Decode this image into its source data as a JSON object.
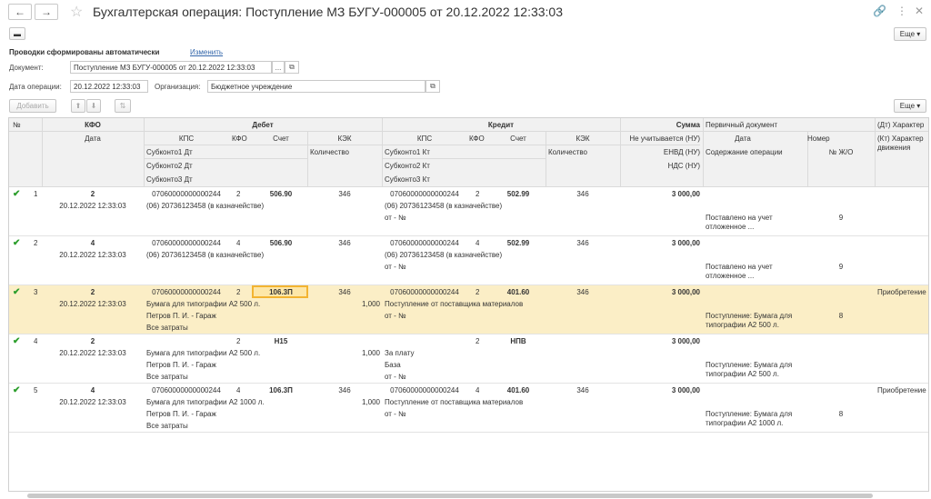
{
  "window": {
    "title": "Бухгалтерская операция: Поступление МЗ БУГУ-000005 от 20.12.2022 12:33:03",
    "more_label": "Еще"
  },
  "form": {
    "auto_text": "Проводки сформированы автоматически",
    "change_link": "Изменить",
    "document_label": "Документ:",
    "document_value": "Поступление МЗ БУГУ-000005 от 20.12.2022 12:33:03",
    "date_label": "Дата операции:",
    "date_value": "20.12.2022 12:33:03",
    "org_label": "Организация:",
    "org_value": "Бюджетное учреждение"
  },
  "toolbar": {
    "add_label": "Добавить",
    "more_label": "Еще"
  },
  "table": {
    "header": {
      "num": "№",
      "kfo": "КФО",
      "date": "Дата",
      "debit": "Дебет",
      "credit": "Кредит",
      "sum": "Сумма",
      "kps": "КПС",
      "kfo_small": "КФО",
      "account": "Счет",
      "kek": "КЭК",
      "qty": "Количество",
      "sub1_dt": "Субконто1 Дт",
      "sub2_dt": "Субконто2 Дт",
      "sub3_dt": "Субконто3 Дт",
      "sub1_kt": "Субконто1 Кт",
      "sub2_kt": "Субконто2 Кт",
      "sub3_kt": "Субконто3 Кт",
      "not_tax": "Не учитывается (НУ)",
      "envd": "ЕНВД (НУ)",
      "nds": "НДС (НУ)",
      "primary_doc": "Первичный документ",
      "pd_date": "Дата",
      "pd_number": "Номер",
      "content": "Содержание операции",
      "journal": "№ Ж/О",
      "dt_char": "(Дт) Характер",
      "kt_char": "(Кт) Характер движения"
    },
    "rows": [
      {
        "num": "1",
        "kfo": "2",
        "date": "20.12.2022 12:33:03",
        "dt_kps": "07060000000000244",
        "dt_kfo": "2",
        "dt_acc": "506.90",
        "dt_kek": "346",
        "dt_qty": "",
        "dt_sub1": "(06) 20736123458 (в казначействе)",
        "dt_sub2": "",
        "dt_sub3": "",
        "kt_kps": "07060000000000244",
        "kt_kfo": "2",
        "kt_acc": "502.99",
        "kt_kek": "346",
        "kt_qty": "",
        "kt_sub1": "(06) 20736123458 (в казначействе)",
        "kt_sub2": "от - №",
        "sum": "3 000,00",
        "content": "Поставлено на учет отложенное ...",
        "journal": "9",
        "char": ""
      },
      {
        "num": "2",
        "kfo": "4",
        "date": "20.12.2022 12:33:03",
        "dt_kps": "07060000000000244",
        "dt_kfo": "4",
        "dt_acc": "506.90",
        "dt_kek": "346",
        "dt_qty": "",
        "dt_sub1": "(06) 20736123458 (в казначействе)",
        "dt_sub2": "",
        "dt_sub3": "",
        "kt_kps": "07060000000000244",
        "kt_kfo": "4",
        "kt_acc": "502.99",
        "kt_kek": "346",
        "kt_qty": "",
        "kt_sub1": "(06) 20736123458 (в казначействе)",
        "kt_sub2": "от - №",
        "sum": "3 000,00",
        "content": "Поставлено на учет отложенное ...",
        "journal": "9",
        "char": ""
      },
      {
        "num": "3",
        "kfo": "2",
        "date": "20.12.2022 12:33:03",
        "dt_kps": "07060000000000244",
        "dt_kfo": "2",
        "dt_acc": "106.3П",
        "dt_kek": "346",
        "dt_qty": "1,000",
        "dt_sub1": "Бумага для типографии А2 500 л.",
        "dt_sub2": "Петров П. И. - Гараж",
        "dt_sub3": "Все затраты",
        "kt_kps": "07060000000000244",
        "kt_kfo": "2",
        "kt_acc": "401.60",
        "kt_kek": "346",
        "kt_qty": "",
        "kt_sub1": "Поступление от поставщика материалов",
        "kt_sub2": "от - №",
        "sum": "3 000,00",
        "content": "Поступление: Бумага для типографии А2 500 л.",
        "journal": "8",
        "char": "Приобретение"
      },
      {
        "num": "4",
        "kfo": "2",
        "date": "20.12.2022 12:33:03",
        "dt_kps": "",
        "dt_kfo": "2",
        "dt_acc": "Н15",
        "dt_kek": "",
        "dt_qty": "1,000",
        "dt_sub1": "Бумага для типографии А2 500 л.",
        "dt_sub2": "Петров П. И. - Гараж",
        "dt_sub3": "Все затраты",
        "kt_kps": "",
        "kt_kfo": "2",
        "kt_acc": "НПВ",
        "kt_kek": "",
        "kt_qty": "",
        "kt_sub1": "За плату",
        "kt_sub2": "База",
        "kt_sub3": "от - №",
        "sum": "3 000,00",
        "content": "Поступление: Бумага для типографии А2 500 л.",
        "journal": "",
        "char": ""
      },
      {
        "num": "5",
        "kfo": "4",
        "date": "20.12.2022 12:33:03",
        "dt_kps": "07060000000000244",
        "dt_kfo": "4",
        "dt_acc": "106.3П",
        "dt_kek": "346",
        "dt_qty": "1,000",
        "dt_sub1": "Бумага для типографии А2 1000 л.",
        "dt_sub2": "Петров П. И. - Гараж",
        "dt_sub3": "Все затраты",
        "kt_kps": "07060000000000244",
        "kt_kfo": "4",
        "kt_acc": "401.60",
        "kt_kek": "346",
        "kt_qty": "",
        "kt_sub1": "Поступление от поставщика материалов",
        "kt_sub2": "от - №",
        "sum": "3 000,00",
        "content": "Поступление: Бумага для типографии А2 1000 л.",
        "journal": "8",
        "char": "Приобретение"
      }
    ]
  }
}
